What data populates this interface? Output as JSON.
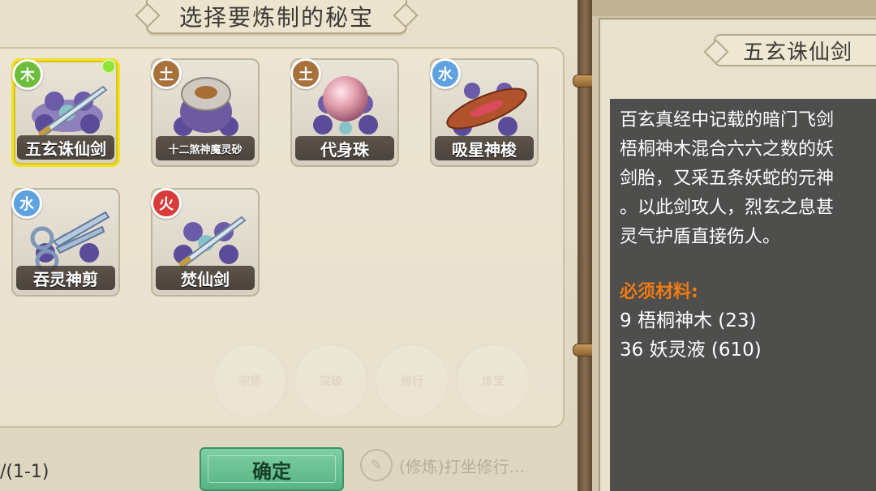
{
  "header": {
    "title": "选择要炼制的秘宝"
  },
  "items": [
    {
      "name": "五玄诛仙剑",
      "element": "木",
      "element_color": "#6cbd3a",
      "selected": true,
      "art": "sword-icon"
    },
    {
      "name": "十二煞神魔灵砂",
      "element": "土",
      "element_color": "#a8703a",
      "selected": false,
      "art": "sand-pot-icon"
    },
    {
      "name": "代身珠",
      "element": "土",
      "element_color": "#a8703a",
      "selected": false,
      "art": "pearl-icon"
    },
    {
      "name": "吸星神梭",
      "element": "水",
      "element_color": "#5fa2e0",
      "selected": false,
      "art": "shuttle-icon"
    },
    {
      "name": "吞灵神剪",
      "element": "水",
      "element_color": "#5fa2e0",
      "selected": false,
      "art": "scissors-icon"
    },
    {
      "name": "焚仙剑",
      "element": "火",
      "element_color": "#d93a3a",
      "selected": false,
      "art": "sword-icon"
    }
  ],
  "faded_menu": [
    "宗师",
    "突破",
    "修行",
    "炼宝"
  ],
  "footer": {
    "progress": "/(1-1)",
    "confirm_label": "确定",
    "cultivate_hint": "(修炼)打坐修行..."
  },
  "detail": {
    "title": "五玄诛仙剑",
    "description": [
      "百玄真经中记载的暗门飞剑",
      "梧桐神木混合六六之数的妖",
      "剑胎，又采五条妖蛇的元神",
      "。以此剑攻人，烈玄之息甚",
      "灵气护盾直接伤人。"
    ],
    "materials_header": "必须材料:",
    "materials": [
      "9 梧桐神木 (23)",
      "36 妖灵液 (610)"
    ]
  },
  "colors": {
    "accent_selected": "#f0e02a",
    "materials_header": "#ef7a14",
    "confirm_button": "#56b483"
  }
}
